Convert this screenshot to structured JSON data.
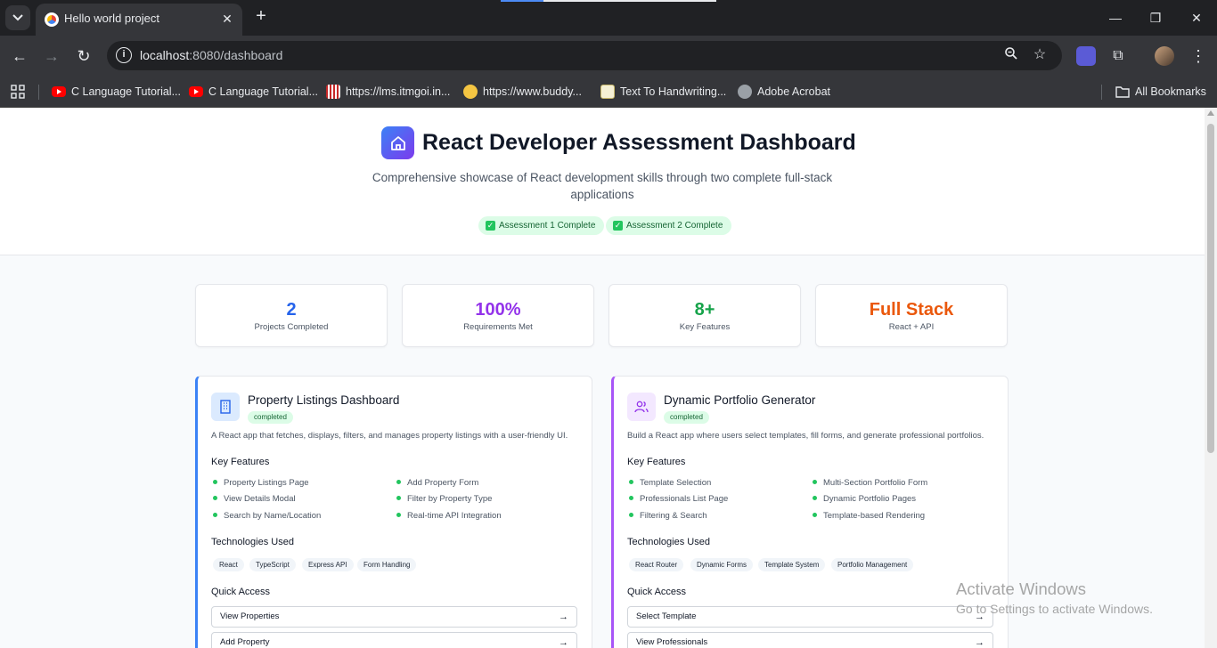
{
  "browser": {
    "tab_title": "Hello world project",
    "url_host": "localhost",
    "url_rest": ":8080/dashboard",
    "bookmarks": [
      {
        "label": "C Language Tutorial...",
        "icon": "youtube-icon"
      },
      {
        "label": "C Language Tutorial...",
        "icon": "youtube-icon"
      },
      {
        "label": "https://lms.itmgoi.in...",
        "icon": "lms-icon"
      },
      {
        "label": "https://www.buddy...",
        "icon": "buddy-icon"
      },
      {
        "label": "Text To Handwriting...",
        "icon": "notepad-icon"
      },
      {
        "label": "Adobe Acrobat",
        "icon": "globe-icon"
      }
    ],
    "all_bookmarks": "All Bookmarks"
  },
  "hero": {
    "title": "React Developer Assessment Dashboard",
    "subtitle": "Comprehensive showcase of React development skills through two complete full-stack applications",
    "badges": [
      "Assessment 1 Complete",
      "Assessment 2 Complete"
    ]
  },
  "stats": [
    {
      "value": "2",
      "label": "Projects Completed",
      "color": "#2563eb"
    },
    {
      "value": "100%",
      "label": "Requirements Met",
      "color": "#9333ea"
    },
    {
      "value": "8+",
      "label": "Key Features",
      "color": "#16a34a"
    },
    {
      "value": "Full Stack",
      "label": "React + API",
      "color": "#ea580c"
    }
  ],
  "projects": [
    {
      "title": "Property Listings Dashboard",
      "status": "completed",
      "description": "A React app that fetches, displays, filters, and manages property listings with a user-friendly UI.",
      "features_heading": "Key Features",
      "features": [
        "Property Listings Page",
        "Add Property Form",
        "View Details Modal",
        "Filter by Property Type",
        "Search by Name/Location",
        "Real-time API Integration"
      ],
      "tech_heading": "Technologies Used",
      "technologies": [
        "React",
        "TypeScript",
        "Express API",
        "Form Handling"
      ],
      "quick_heading": "Quick Access",
      "quick_links": [
        "View Properties",
        "Add Property"
      ],
      "accent": "#3b82f6"
    },
    {
      "title": "Dynamic Portfolio Generator",
      "status": "completed",
      "description": "Build a React app where users select templates, fill forms, and generate professional portfolios.",
      "features_heading": "Key Features",
      "features": [
        "Template Selection",
        "Multi-Section Portfolio Form",
        "Professionals List Page",
        "Dynamic Portfolio Pages",
        "Filtering & Search",
        "Template-based Rendering"
      ],
      "tech_heading": "Technologies Used",
      "technologies": [
        "React Router",
        "Dynamic Forms",
        "Template System",
        "Portfolio Management"
      ],
      "quick_heading": "Quick Access",
      "quick_links": [
        "Select Template",
        "View Professionals"
      ],
      "accent": "#a855f7"
    }
  ],
  "watermark": {
    "line1": "Activate Windows",
    "line2": "Go to Settings to activate Windows."
  }
}
